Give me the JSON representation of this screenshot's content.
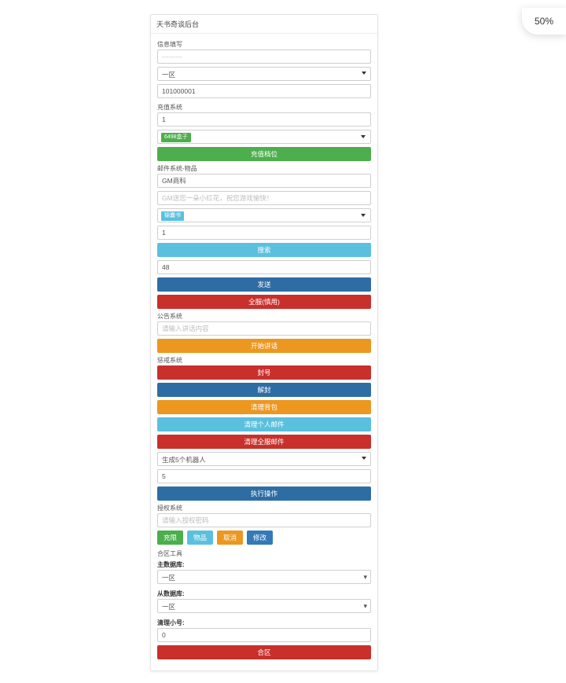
{
  "zoom_label": "50%",
  "panel_title": "天书奇谈后台",
  "sections": {
    "signal": {
      "label": "信息填写",
      "placeholder": "---------",
      "zone_selected": "一区",
      "value_input": "101000001"
    },
    "recharge": {
      "label": "充值系统",
      "input_value": "1",
      "pill_text": "6498盒子",
      "btn_label": "充值档位"
    },
    "mail": {
      "label": "邮件系统-物品",
      "title_value": "GM商科",
      "content_placeholder": "GM送您一朵小红花，祝您游戏愉快！",
      "pill_text": "锦囊书",
      "num_value": "1",
      "search_btn": "搜索",
      "amount_value": "48",
      "send_btn": "发送",
      "disable_btn": "全服(慎用)"
    },
    "announce": {
      "label": "公告系统",
      "placeholder": "请输入讲话内容",
      "btn_label": "开始讲话"
    },
    "punish": {
      "label": "惩戒系统",
      "ban_btn": "封号",
      "unban_btn": "解封",
      "clear_bag_btn": "清理背包",
      "clear_personal_mail_btn": "清理个人邮件",
      "clear_all_mail_btn": "清理全服邮件"
    },
    "robot": {
      "select_value": "生成5个机器人",
      "num_value": "5",
      "exec_btn": "执行操作"
    },
    "auth": {
      "label": "授权系统",
      "placeholder": "请输入授权密码",
      "btn_full": "充限",
      "btn_item": "物品",
      "btn_cancel": "取消",
      "btn_modify": "修改"
    },
    "merge": {
      "tool_label": "合区工具",
      "main_db_label": "主数据库:",
      "main_db_value": "一区",
      "from_db_label": "从数据库:",
      "from_db_value": "一区",
      "clear_sub_label": "清理小号:",
      "clear_sub_value": "0",
      "merge_btn": "合区"
    }
  }
}
